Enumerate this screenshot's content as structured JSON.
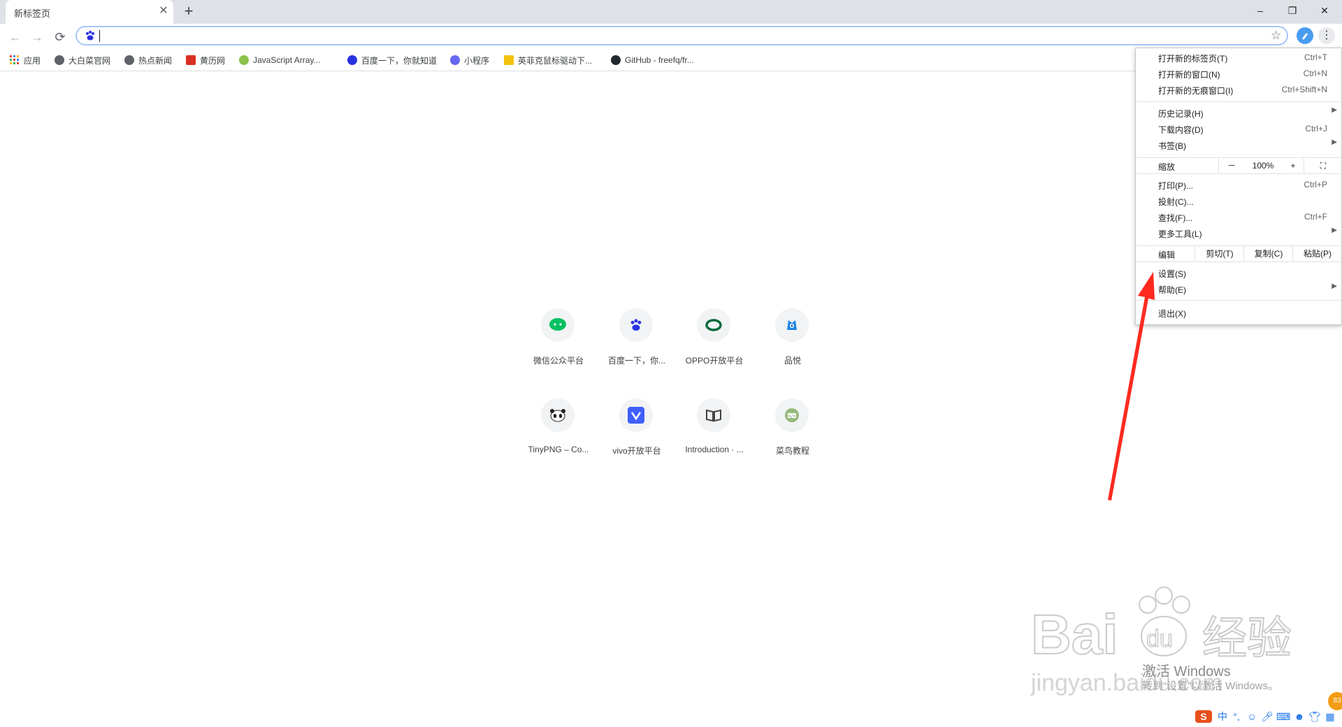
{
  "tab": {
    "title": "新标签页"
  },
  "window": {
    "minimize": "–",
    "restore": "❐",
    "close": "✕"
  },
  "toolbar": {
    "back": "←",
    "forward": "→",
    "reload": "⟳",
    "omnibox_value": ""
  },
  "bookmarks": [
    {
      "label": "应用",
      "icon": "apps-grid-icon"
    },
    {
      "label": "大白菜官网",
      "icon": "globe-icon"
    },
    {
      "label": "热点新闻",
      "icon": "globe-icon"
    },
    {
      "label": "黄历网",
      "icon": "calendar-icon"
    },
    {
      "label": "JavaScript Array...",
      "icon": "js-icon"
    },
    {
      "label": "百度一下，你就知道",
      "icon": "baidu-icon"
    },
    {
      "label": "小程序",
      "icon": "miniprogram-icon"
    },
    {
      "label": "英菲克鼠标驱动下...",
      "icon": "mouse-icon"
    },
    {
      "label": "GitHub - freefq/fr...",
      "icon": "github-icon"
    }
  ],
  "shortcuts": [
    {
      "label": "微信公众平台",
      "icon": "wechat-icon"
    },
    {
      "label": "百度一下，你...",
      "icon": "baidu-icon"
    },
    {
      "label": "OPPO开放平台",
      "icon": "oppo-icon"
    },
    {
      "label": "品悦",
      "icon": "pinyue-icon"
    },
    {
      "label": "TinyPNG – Co...",
      "icon": "panda-icon"
    },
    {
      "label": "vivo开放平台",
      "icon": "vivo-icon"
    },
    {
      "label": "Introduction · ...",
      "icon": "book-icon"
    },
    {
      "label": "菜鸟教程",
      "icon": "runoob-icon"
    }
  ],
  "menu": {
    "new_tab": {
      "label": "打开新的标签页(T)",
      "shortcut": "Ctrl+T"
    },
    "new_window": {
      "label": "打开新的窗口(N)",
      "shortcut": "Ctrl+N"
    },
    "new_incognito": {
      "label": "打开新的无痕窗口(I)",
      "shortcut": "Ctrl+Shift+N"
    },
    "history": {
      "label": "历史记录(H)"
    },
    "downloads": {
      "label": "下载内容(D)",
      "shortcut": "Ctrl+J"
    },
    "bookmarks": {
      "label": "书签(B)"
    },
    "zoom": {
      "label": "缩放",
      "minus": "－",
      "value": "100%",
      "plus": "+"
    },
    "print": {
      "label": "打印(P)...",
      "shortcut": "Ctrl+P"
    },
    "cast": {
      "label": "投射(C)..."
    },
    "find": {
      "label": "查找(F)...",
      "shortcut": "Ctrl+F"
    },
    "more_tools": {
      "label": "更多工具(L)"
    },
    "edit": {
      "label": "编辑",
      "cut": "剪切(T)",
      "copy": "复制(C)",
      "paste": "粘贴(P)"
    },
    "settings": {
      "label": "设置(S)"
    },
    "help": {
      "label": "帮助(E)"
    },
    "exit": {
      "label": "退出(X)"
    }
  },
  "watermark": {
    "brand": "Bai du 经验",
    "url": "jingyan.baidu.com"
  },
  "activation": {
    "line1": "激活 Windows",
    "line2": "转到“设置”以激活 Windows。"
  },
  "tray": {
    "ime": "中",
    "badge": "83"
  },
  "colors": {
    "accent": "#1a73e8",
    "arrow": "#ff2a1f",
    "wechat": "#07c160",
    "oppo": "#0a6b3f",
    "vivo": "#415fff",
    "baidu": "#2932e1"
  }
}
